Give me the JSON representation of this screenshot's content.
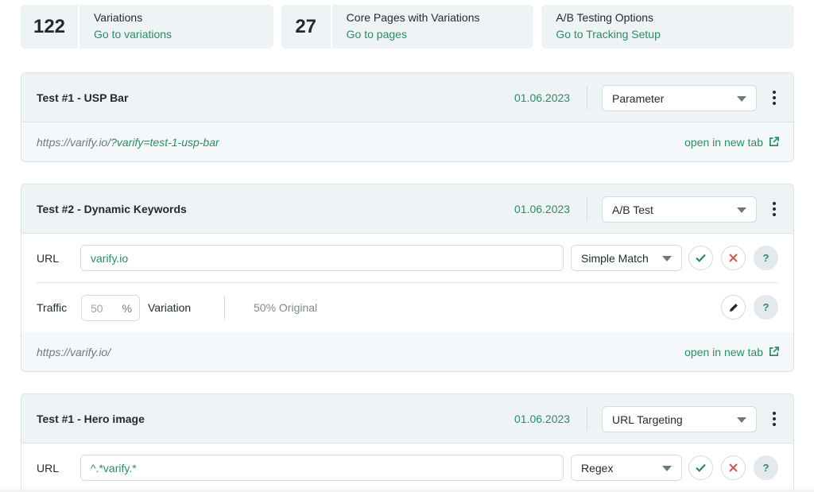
{
  "stats": [
    {
      "number": "122",
      "title": "Variations",
      "link": "Go to variations"
    },
    {
      "number": "27",
      "title": "Core Pages with Variations",
      "link": "Go to pages"
    },
    {
      "number": "",
      "title": "A/B Testing Options",
      "link": "Go to Tracking Setup"
    }
  ],
  "tests": [
    {
      "title": "Test #1 - USP Bar",
      "date": "01.06.2023",
      "type": "Parameter",
      "url_prefix": "https://varify.io/",
      "url_param": "?varify=test-1-usp-bar",
      "open_label": "open in new tab"
    },
    {
      "title": "Test #2 - Dynamic Keywords",
      "date": "01.06.2023",
      "type": "A/B Test",
      "url_label": "URL",
      "url_value": "varify.io",
      "match_type": "Simple Match",
      "help": "?",
      "traffic_label": "Traffic",
      "traffic_value": "50",
      "traffic_unit": "%",
      "variation_label": "Variation",
      "original_text": "50% Original",
      "url_prefix": "https://varify.io/",
      "open_label": "open in new tab"
    },
    {
      "title": "Test #1 - Hero image",
      "date": "01.06.2023",
      "type": "URL Targeting",
      "url_label": "URL",
      "url_value": "^.*varify.*",
      "match_type": "Regex",
      "help": "?"
    }
  ],
  "colors": {
    "accent": "#2e8b63",
    "danger": "#d9534f",
    "panel": "#eef3f6",
    "text": "#1f2a2e"
  },
  "icons": [
    "kebab-menu-icon",
    "external-link-icon",
    "check-icon",
    "close-icon",
    "pencil-icon",
    "caret-down-icon"
  ]
}
